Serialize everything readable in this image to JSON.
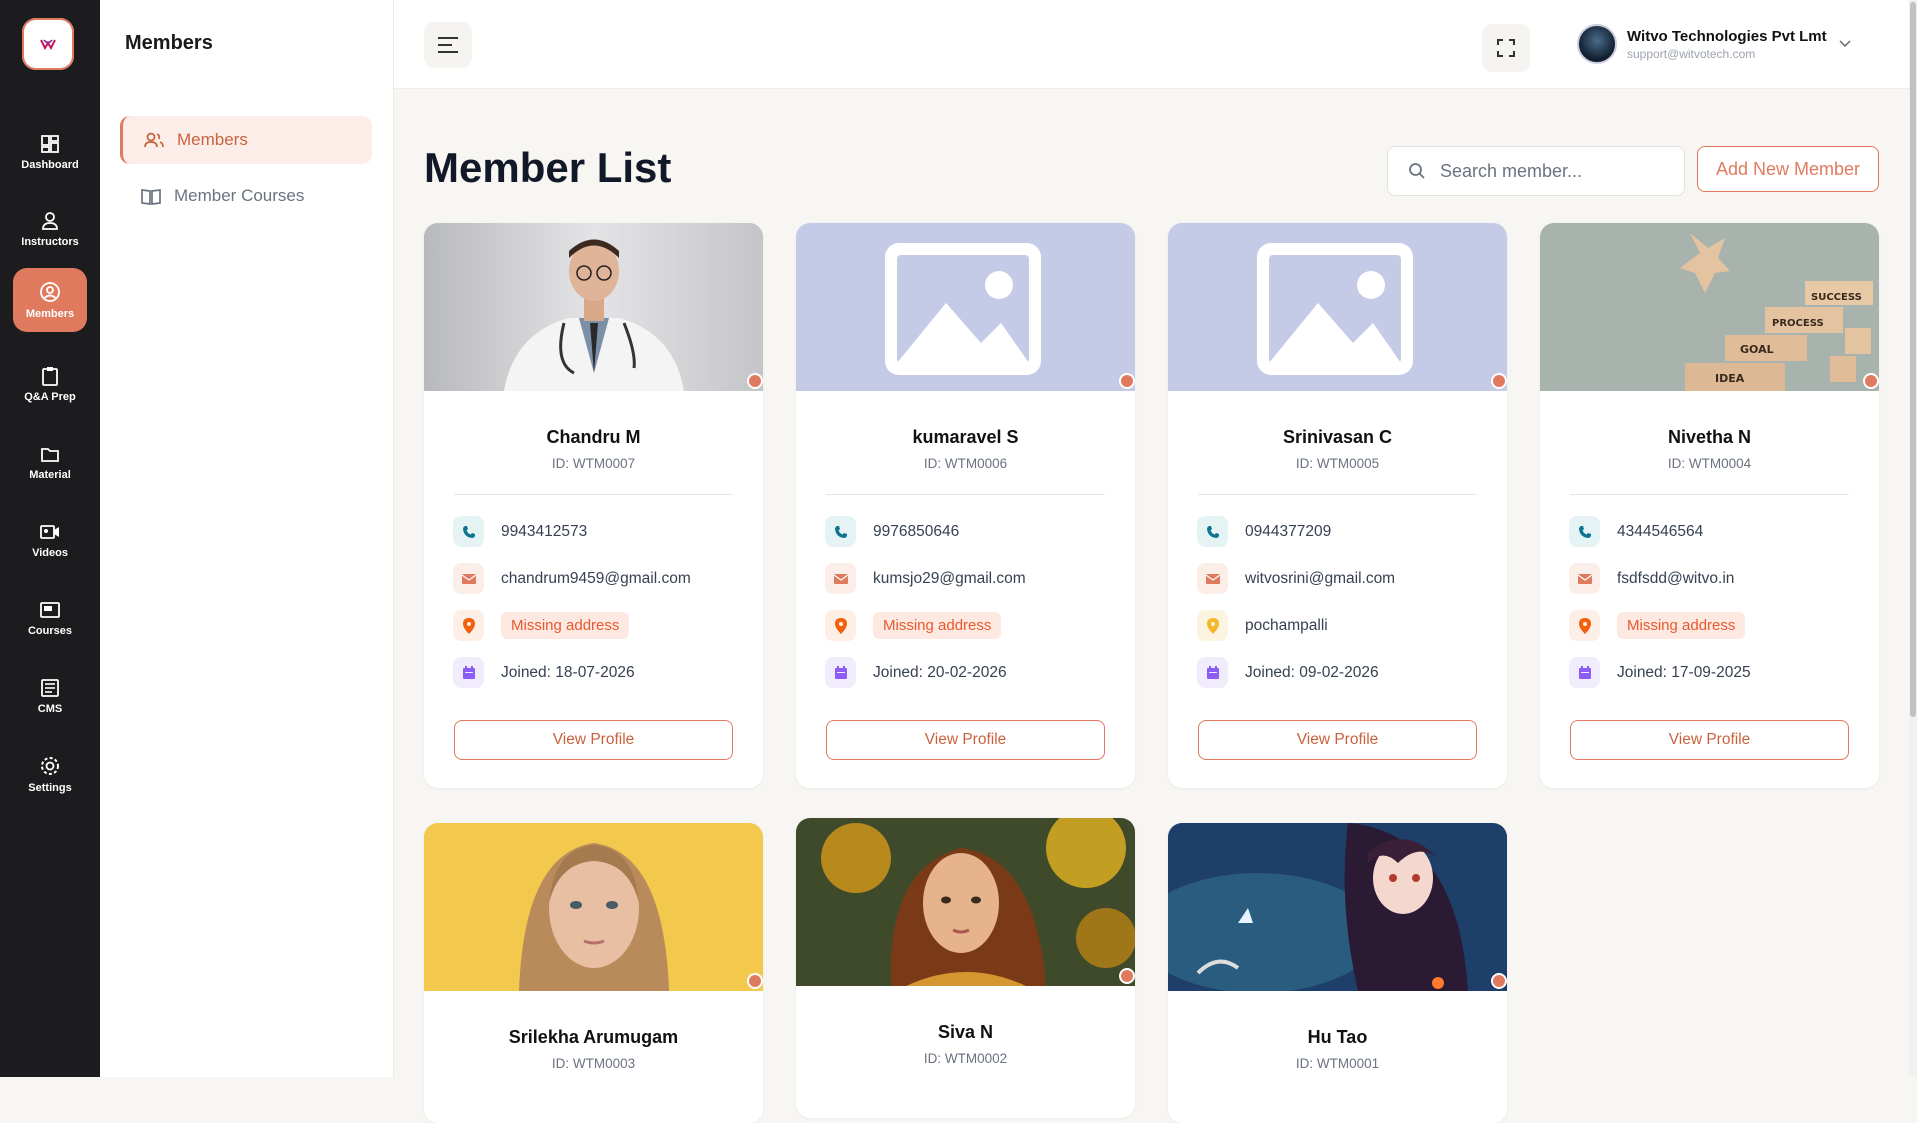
{
  "rail": {
    "items": [
      {
        "label": "Dashboard",
        "icon": "dashboard-icon"
      },
      {
        "label": "Instructors",
        "icon": "user-icon"
      },
      {
        "label": "Members",
        "icon": "user-circle-icon"
      },
      {
        "label": "Q&A Prep",
        "icon": "clipboard-icon"
      },
      {
        "label": "Material",
        "icon": "folder-icon"
      },
      {
        "label": "Videos",
        "icon": "video-icon"
      },
      {
        "label": "Courses",
        "icon": "courses-icon"
      },
      {
        "label": "CMS",
        "icon": "cms-icon"
      },
      {
        "label": "Settings",
        "icon": "gear-icon"
      }
    ],
    "active": "Members"
  },
  "sidebar": {
    "title": "Members",
    "items": [
      {
        "label": "Members",
        "icon": "users-icon"
      },
      {
        "label": "Member Courses",
        "icon": "book-icon"
      }
    ]
  },
  "header": {
    "user_name": "Witvo Technologies Pvt Lmt",
    "user_email": "support@witvotech.com"
  },
  "main": {
    "title": "Member List",
    "search_placeholder": "Search member...",
    "add_button": "Add New Member",
    "view_profile_label": "View Profile"
  },
  "members": [
    {
      "name": "Chandru M",
      "id": "ID: WTM0007",
      "phone": "9943412573",
      "email": "chandrum9459@gmail.com",
      "address": "Missing address",
      "address_missing": true,
      "joined": "Joined: 18-07-2026",
      "photo": "doctor-photo"
    },
    {
      "name": "kumaravel S",
      "id": "ID: WTM0006",
      "phone": "9976850646",
      "email": "kumsjo29@gmail.com",
      "address": "Missing address",
      "address_missing": true,
      "joined": "Joined: 20-02-2026",
      "photo": "placeholder-image"
    },
    {
      "name": "Srinivasan C",
      "id": "ID: WTM0005",
      "phone": "0944377209",
      "email": "witvosrini@gmail.com",
      "address": "pochampalli",
      "address_missing": false,
      "joined": "Joined: 09-02-2026",
      "photo": "placeholder-image"
    },
    {
      "name": "Nivetha N",
      "id": "ID: WTM0004",
      "phone": "4344546564",
      "email": "fsdfsdd@witvo.in",
      "address": "Missing address",
      "address_missing": true,
      "joined": "Joined: 17-09-2025",
      "photo": "blocks-photo"
    },
    {
      "name": "Srilekha Arumugam",
      "id": "ID: WTM0003",
      "photo": "portrait-yellow-photo"
    },
    {
      "name": "Siva N",
      "id": "ID: WTM0002",
      "photo": "portrait-autumn-photo"
    },
    {
      "name": "Hu Tao",
      "id": "ID: WTM0001",
      "photo": "anime-photo"
    }
  ],
  "colors": {
    "accent": "#e07a5f",
    "rail_bg": "#1c1c1e",
    "page_bg": "#f8f6f3",
    "missing_text": "#e8592e"
  }
}
